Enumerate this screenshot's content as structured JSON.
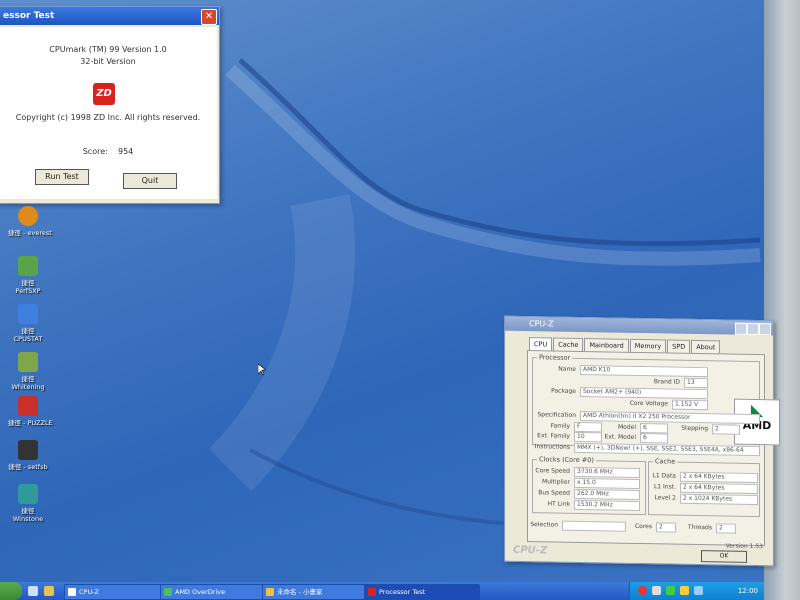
{
  "cpumark": {
    "title": "essor Test",
    "product": "CPUmark (TM) 99 Version 1.0",
    "subtitle": "32-bit Version",
    "logo_text": "ZD",
    "copyright": "Copyright (c) 1998 ZD Inc. All rights reserved.",
    "score_label": "Score:",
    "score_value": "954",
    "run_button": "Run Test",
    "quit_button": "Quit",
    "close_glyph": "✕"
  },
  "desktop_icons": [
    {
      "label": "捷徑 - everest",
      "color": "#e08a1a"
    },
    {
      "label": "捷徑\nPerfSXP",
      "color": "#5aa34a"
    },
    {
      "label": "捷徑\nCPUSTAT",
      "color": "#3f7fe0"
    },
    {
      "label": "捷徑\nWhitening",
      "color": "#7fa64a"
    },
    {
      "label": "捷徑 - PUZZLE",
      "color": "#c9302c"
    },
    {
      "label": "捷徑 - setfsb",
      "color": "#333333"
    },
    {
      "label": "捷徑\nWinstone",
      "color": "#2e9a9a"
    }
  ],
  "cpuz": {
    "title": "CPU-Z",
    "tabs": [
      "CPU",
      "Cache",
      "Mainboard",
      "Memory",
      "SPD",
      "About"
    ],
    "processor_group": "Processor",
    "name_label": "Name",
    "name_value": "AMD K10",
    "codename_label": "",
    "brandid_label": "Brand ID",
    "brandid_value": "13",
    "package_label": "Package",
    "package_value": "Socket AM2+ (940)",
    "voltage_label": "Core Voltage",
    "voltage_value": "1.152 V",
    "spec_label": "Specification",
    "spec_value": "AMD Athlon(tm) II X2 250 Processor",
    "family_label": "Family",
    "family_value": "F",
    "model_label": "Model",
    "model_value": "6",
    "stepping_label": "Stepping",
    "stepping_value": "2",
    "extfamily_label": "Ext. Family",
    "extfamily_value": "10",
    "extmodel_label": "Ext. Model",
    "extmodel_value": "6",
    "instr_label": "Instructions",
    "instr_value": "MMX (+), 3DNow! (+), SSE, SSE2, SSE3, SSE4A, x86-64",
    "clocks_group": "Clocks (Core #0)",
    "speed_label": "Core Speed",
    "speed_value": "3730.6 MHz",
    "mult_label": "Multiplier",
    "mult_value": "x 15.0",
    "bus_label": "Bus Speed",
    "bus_value": "262.0 MHz",
    "ht_label": "HT Link",
    "ht_value": "1530.2 MHz",
    "cache_group": "Cache",
    "l1d_label": "L1 Data",
    "l1d_value": "2 x 64 KBytes",
    "l1i_label": "L1 Inst.",
    "l1i_value": "2 x 64 KBytes",
    "l2_label": "Level 2",
    "l2_value": "2 x 1024 KBytes",
    "selection_label": "Selection",
    "cores_label": "Cores",
    "cores_value": "2",
    "threads_label": "Threads",
    "threads_value": "2",
    "version": "Version 1.53",
    "brand_footer": "CPU-Z",
    "ok_button": "OK",
    "amd_text": "AMD"
  },
  "taskbar": {
    "buttons": [
      {
        "label": "CPU-Z"
      },
      {
        "label": "AMD OverDrive"
      },
      {
        "label": "未命名 - 小畫家"
      },
      {
        "label": "Processor Test"
      }
    ],
    "clock": "12:00"
  }
}
